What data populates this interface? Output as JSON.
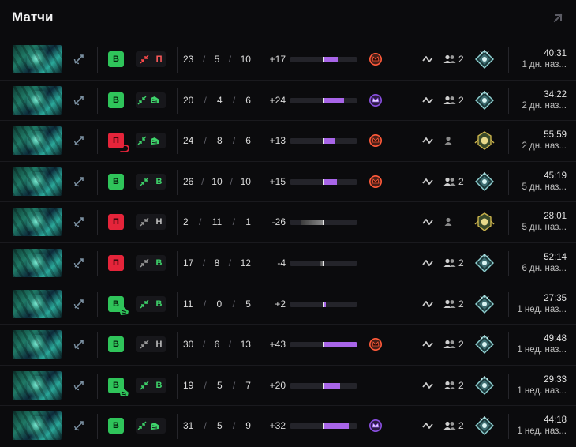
{
  "section": {
    "title": "Матчи"
  },
  "colors": {
    "win": "#2fc45a",
    "loss": "#e5243a",
    "accent_purple": "#9b5de5",
    "medal_orange": "#ff5a3a",
    "medal_purple": "#8a4fe0",
    "neutral_bar": "#7a7a7a"
  },
  "matches": [
    {
      "hero_icon": "hero-portrait",
      "result": "В",
      "result_type": "win",
      "result_sub": null,
      "lane_icon": "lane-arrows-red",
      "lane_text": "П",
      "lane_color": "#ff5a5a",
      "lane_extra_icon": null,
      "kills": "23",
      "deaths": "5",
      "assists": "10",
      "diff": "+17",
      "bar_fill": 0.45,
      "bar_color": "#a865e8",
      "medal": "medal-orange",
      "party": "2",
      "party_icon": "party-icon",
      "rank_icon": "rank-diamond",
      "duration": "40:31",
      "ago": "1 дн. наз..."
    },
    {
      "hero_icon": "hero-portrait",
      "result": "В",
      "result_type": "win",
      "result_sub": null,
      "lane_icon": "lane-arrows-green",
      "lane_text": "",
      "lane_color": "#3ed36b",
      "lane_extra_icon": "boots-icon",
      "kills": "20",
      "deaths": "4",
      "assists": "6",
      "diff": "+24",
      "bar_fill": 0.63,
      "bar_color": "#a865e8",
      "medal": "medal-purple",
      "party": "2",
      "party_icon": "party-icon",
      "rank_icon": "rank-diamond",
      "duration": "34:22",
      "ago": "2 дн. наз..."
    },
    {
      "hero_icon": "hero-portrait",
      "result": "П",
      "result_type": "loss",
      "result_sub": "undo-arrow",
      "lane_icon": "lane-arrows-green",
      "lane_text": "",
      "lane_color": "#3ed36b",
      "lane_extra_icon": "boots-icon",
      "kills": "24",
      "deaths": "8",
      "assists": "6",
      "diff": "+13",
      "bar_fill": 0.35,
      "bar_color": "#a865e8",
      "medal": "medal-orange",
      "party": "",
      "party_icon": "solo-icon",
      "rank_icon": "rank-gold",
      "duration": "55:59",
      "ago": "2 дн. наз..."
    },
    {
      "hero_icon": "hero-portrait",
      "result": "В",
      "result_type": "win",
      "result_sub": null,
      "lane_icon": "lane-arrows-green",
      "lane_text": "В",
      "lane_color": "#3ed36b",
      "lane_extra_icon": null,
      "kills": "26",
      "deaths": "10",
      "assists": "10",
      "diff": "+15",
      "bar_fill": 0.4,
      "bar_color": "#a865e8",
      "medal": "medal-orange",
      "party": "2",
      "party_icon": "party-icon",
      "rank_icon": "rank-diamond",
      "duration": "45:19",
      "ago": "5 дн. наз..."
    },
    {
      "hero_icon": "hero-portrait",
      "result": "П",
      "result_type": "loss",
      "result_sub": null,
      "lane_icon": "lane-arrows-gray",
      "lane_text": "Н",
      "lane_color": "#bdbdbd",
      "lane_extra_icon": null,
      "kills": "2",
      "deaths": "11",
      "assists": "1",
      "diff": "-26",
      "bar_fill": -0.68,
      "bar_color": "#8a8a8a",
      "medal": null,
      "party": "",
      "party_icon": "solo-icon",
      "rank_icon": "rank-gold",
      "duration": "28:01",
      "ago": "5 дн. наз..."
    },
    {
      "hero_icon": "hero-portrait",
      "result": "П",
      "result_type": "loss",
      "result_sub": null,
      "lane_icon": "lane-arrows-gray",
      "lane_text": "В",
      "lane_color": "#3ed36b",
      "lane_extra_icon": null,
      "kills": "17",
      "deaths": "8",
      "assists": "12",
      "diff": "-4",
      "bar_fill": -0.12,
      "bar_color": "#8a8a8a",
      "medal": null,
      "party": "2",
      "party_icon": "party-icon",
      "rank_icon": "rank-diamond",
      "duration": "52:14",
      "ago": "6 дн. наз..."
    },
    {
      "hero_icon": "hero-portrait",
      "result": "В",
      "result_type": "win",
      "result_sub": "boots",
      "lane_icon": "lane-arrows-green",
      "lane_text": "В",
      "lane_color": "#3ed36b",
      "lane_extra_icon": null,
      "kills": "11",
      "deaths": "0",
      "assists": "5",
      "diff": "+2",
      "bar_fill": 0.07,
      "bar_color": "#a865e8",
      "medal": null,
      "party": "2",
      "party_icon": "party-icon",
      "rank_icon": "rank-diamond",
      "duration": "27:35",
      "ago": "1 нед. наз..."
    },
    {
      "hero_icon": "hero-portrait",
      "result": "В",
      "result_type": "win",
      "result_sub": null,
      "lane_icon": "lane-arrows-gray",
      "lane_text": "Н",
      "lane_color": "#bdbdbd",
      "lane_extra_icon": null,
      "kills": "30",
      "deaths": "6",
      "assists": "13",
      "diff": "+43",
      "bar_fill": 1.0,
      "bar_color": "#a865e8",
      "medal": "medal-orange",
      "party": "2",
      "party_icon": "party-icon",
      "rank_icon": "rank-diamond",
      "duration": "49:48",
      "ago": "1 нед. наз..."
    },
    {
      "hero_icon": "hero-portrait",
      "result": "В",
      "result_type": "win",
      "result_sub": "boots",
      "lane_icon": "lane-arrows-green",
      "lane_text": "В",
      "lane_color": "#3ed36b",
      "lane_extra_icon": null,
      "kills": "19",
      "deaths": "5",
      "assists": "7",
      "diff": "+20",
      "bar_fill": 0.49,
      "bar_color": "#a865e8",
      "medal": null,
      "party": "2",
      "party_icon": "party-icon",
      "rank_icon": "rank-diamond",
      "duration": "29:33",
      "ago": "1 нед. наз..."
    },
    {
      "hero_icon": "hero-portrait",
      "result": "В",
      "result_type": "win",
      "result_sub": null,
      "lane_icon": "lane-arrows-green",
      "lane_text": "",
      "lane_color": "#3ed36b",
      "lane_extra_icon": "boots-icon",
      "kills": "31",
      "deaths": "5",
      "assists": "9",
      "diff": "+32",
      "bar_fill": 0.77,
      "bar_color": "#a865e8",
      "medal": "medal-purple",
      "party": "2",
      "party_icon": "party-icon",
      "rank_icon": "rank-diamond",
      "duration": "44:18",
      "ago": "1 нед. наз..."
    }
  ]
}
